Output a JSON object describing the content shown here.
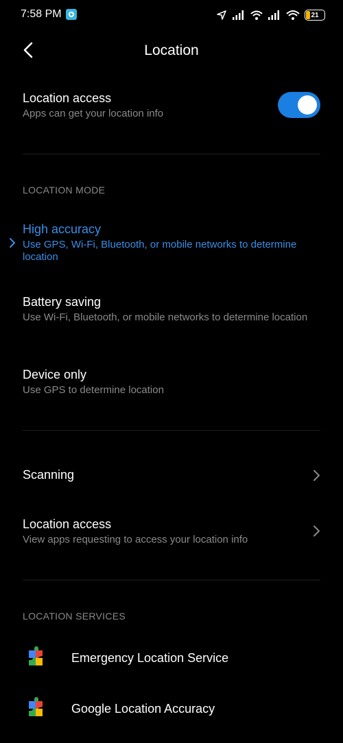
{
  "status_bar": {
    "time": "7:58 PM",
    "battery_level": "21",
    "battery_percent": 21,
    "icons": [
      "navigation-arrow-icon",
      "signal-icon",
      "wifi-icon",
      "signal-icon",
      "wifi-icon",
      "battery-icon"
    ]
  },
  "header": {
    "title": "Location"
  },
  "location_access_toggle": {
    "title": "Location access",
    "subtitle": "Apps can get your location info",
    "enabled": true
  },
  "location_mode": {
    "section_label": "LOCATION MODE",
    "options": [
      {
        "title": "High accuracy",
        "subtitle": "Use GPS, Wi-Fi, Bluetooth, or mobile networks to determine location",
        "selected": true
      },
      {
        "title": "Battery saving",
        "subtitle": "Use Wi-Fi, Bluetooth, or mobile networks to determine location",
        "selected": false
      },
      {
        "title": "Device only",
        "subtitle": "Use GPS to determine location",
        "selected": false
      }
    ]
  },
  "more": {
    "scanning_label": "Scanning",
    "location_access_title": "Location access",
    "location_access_subtitle": "View apps requesting to access your location info"
  },
  "location_services": {
    "section_label": "LOCATION SERVICES",
    "items": [
      {
        "label": "Emergency Location Service",
        "icon": "google-play-services-icon"
      },
      {
        "label": "Google Location Accuracy",
        "icon": "google-play-services-icon"
      }
    ]
  },
  "colors": {
    "background": "#000000",
    "accent": "#3a8ee6",
    "toggle_on": "#1a7fe0",
    "secondary_text": "#8a8a8a"
  }
}
